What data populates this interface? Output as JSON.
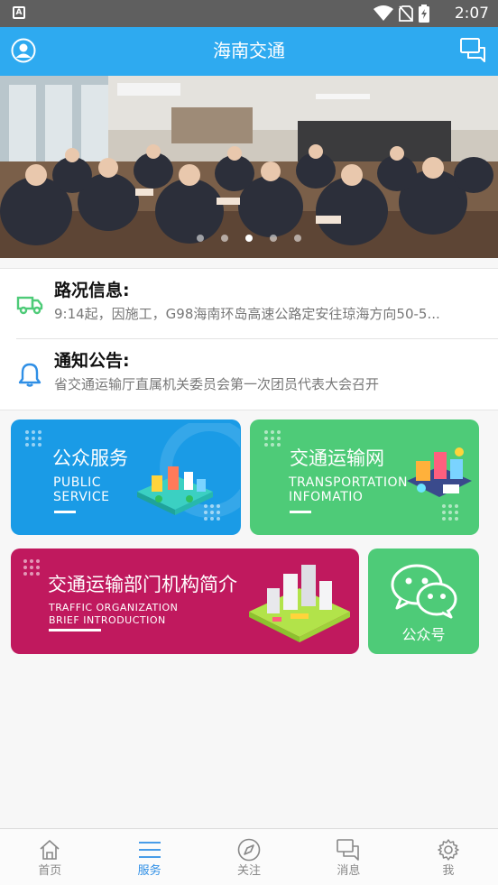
{
  "status_bar": {
    "time": "2:07"
  },
  "header": {
    "title": "海南交通"
  },
  "banner": {
    "slides": 5,
    "active_index": 2
  },
  "info": {
    "traffic": {
      "title": "路况信息:",
      "text": "9:14起，因施工，G98海南环岛高速公路定安往琼海方向50-5..."
    },
    "notice": {
      "title": "通知公告:",
      "text": "省交通运输厅直属机关委员会第一次团员代表大会召开"
    }
  },
  "cards": {
    "public_service": {
      "cn": "公众服务",
      "en1": "PUBLIC",
      "en2": "SERVICE"
    },
    "transport_net": {
      "cn": "交通运输网",
      "en1": "TRANSPORTATION",
      "en2": "INFOMATIO"
    },
    "organization": {
      "cn": "交通运输部门机构简介",
      "en1": "TRAFFIC  ORGANIZATION",
      "en2": "BRIEF INTRODUCTION"
    },
    "wechat": {
      "label": "公众号"
    }
  },
  "tabbar": {
    "tabs": [
      {
        "label": "首页",
        "icon": "home-icon"
      },
      {
        "label": "服务",
        "icon": "menu-icon"
      },
      {
        "label": "关注",
        "icon": "compass-icon"
      },
      {
        "label": "消息",
        "icon": "chat-icon"
      },
      {
        "label": "我",
        "icon": "gear-icon"
      }
    ],
    "active": "服务"
  },
  "colors": {
    "header": "#2eaaf0",
    "active_tab": "#2f8fe6",
    "public_service": "#1a9be6",
    "transport": "#4ecb78",
    "organization": "#c0195e",
    "traffic_icon": "#4ecb78",
    "notice_icon": "#2f8fe6"
  }
}
